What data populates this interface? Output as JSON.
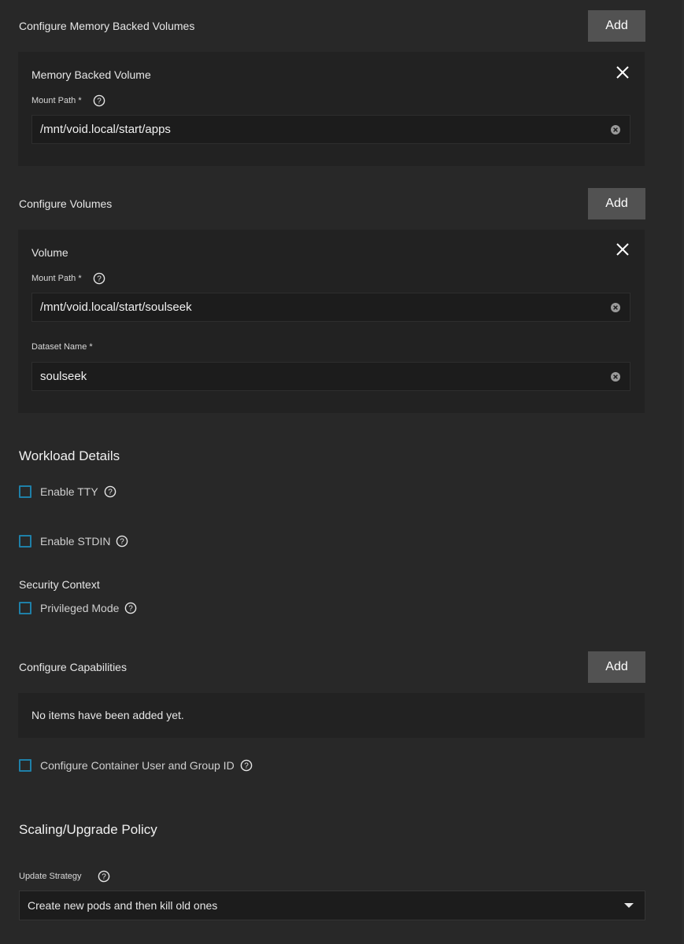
{
  "memory_volumes": {
    "label": "Configure Memory Backed Volumes",
    "add_label": "Add",
    "item": {
      "title": "Memory Backed Volume",
      "mount_path_label": "Mount Path *",
      "mount_path_value": "/mnt/void.local/start/apps"
    }
  },
  "volumes": {
    "label": "Configure Volumes",
    "add_label": "Add",
    "item": {
      "title": "Volume",
      "mount_path_label": "Mount Path *",
      "mount_path_value": "/mnt/void.local/start/soulseek",
      "dataset_name_label": "Dataset Name *",
      "dataset_name_value": "soulseek"
    }
  },
  "workload": {
    "heading": "Workload Details",
    "enable_tty": "Enable TTY",
    "enable_stdin": "Enable STDIN",
    "security_context_label": "Security Context",
    "privileged_mode": "Privileged Mode"
  },
  "capabilities": {
    "label": "Configure Capabilities",
    "add_label": "Add",
    "empty_text": "No items have been added yet."
  },
  "container_user": {
    "label": "Configure Container User and Group ID"
  },
  "scaling": {
    "heading": "Scaling/Upgrade Policy",
    "update_strategy_label": "Update Strategy",
    "update_strategy_value": "Create new pods and then kill old ones"
  },
  "icons": {
    "help": "help-circle-icon",
    "close": "close-icon",
    "clear": "clear-circle-icon",
    "dropdown": "chevron-down-icon"
  },
  "colors": {
    "background": "#282828",
    "card": "#222222",
    "button": "#525252",
    "checkbox_border": "#1f80a8"
  }
}
